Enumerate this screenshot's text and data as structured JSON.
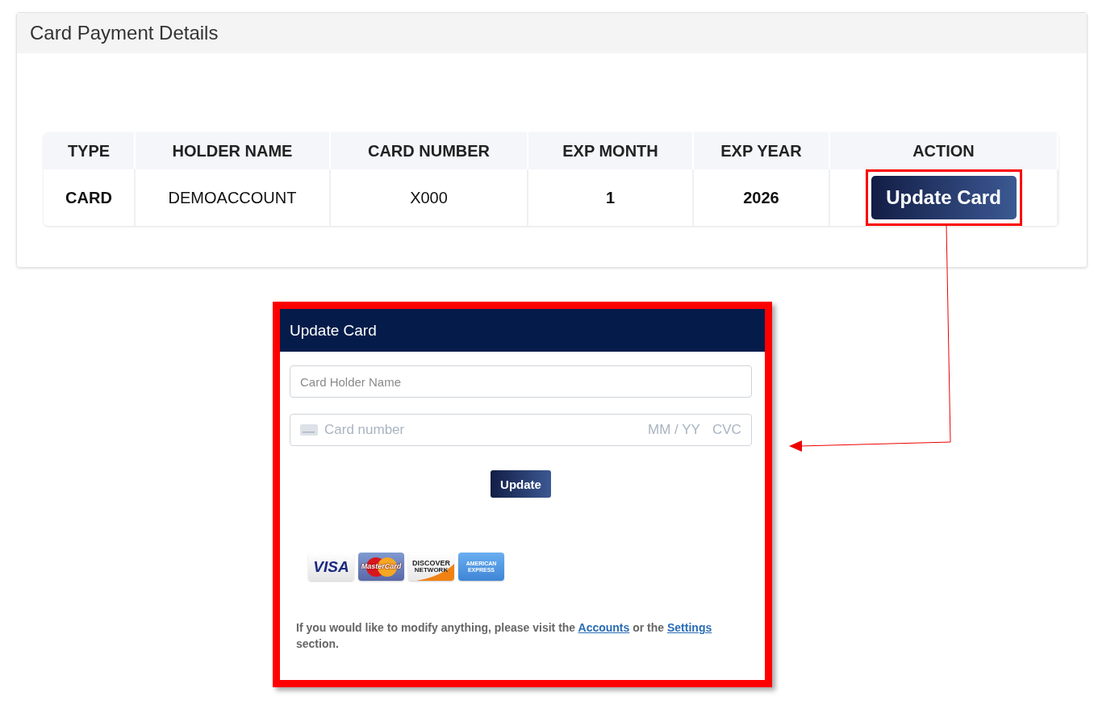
{
  "panel": {
    "title": "Card Payment Details"
  },
  "table": {
    "columns": [
      "TYPE",
      "HOLDER NAME",
      "CARD NUMBER",
      "EXP MONTH",
      "EXP YEAR",
      "ACTION"
    ],
    "rows": [
      {
        "cells": [
          "CARD",
          "DEMOACCOUNT",
          "X000",
          "1",
          "2026"
        ],
        "action": "Update Card",
        "highlighted": true
      }
    ]
  },
  "dialog": {
    "title": "Update Card",
    "holder_field": {
      "placeholder": "Card Holder Name"
    },
    "card_field": {
      "number_placeholder": "Card number",
      "expiry_placeholder": "MM / YY",
      "cvc_placeholder": "CVC"
    },
    "button": "Update",
    "card_logos": [
      {
        "kind": "visa",
        "lines": [
          "VISA"
        ]
      },
      {
        "kind": "mastercard",
        "lines": [
          "MasterCard"
        ]
      },
      {
        "kind": "discover",
        "lines": [
          "DISCOVER",
          "NETWORK"
        ]
      },
      {
        "kind": "amex",
        "lines": [
          "AMERICAN",
          "EXPRESS"
        ]
      }
    ],
    "note": [
      {
        "kind": "text",
        "text": " If you would like to modify anything, please visit the "
      },
      {
        "kind": "link",
        "text": "Accounts"
      },
      {
        "kind": "text",
        "text": " or the "
      },
      {
        "kind": "link",
        "text": "Settings"
      },
      {
        "kind": "text",
        "text": " section."
      }
    ]
  }
}
